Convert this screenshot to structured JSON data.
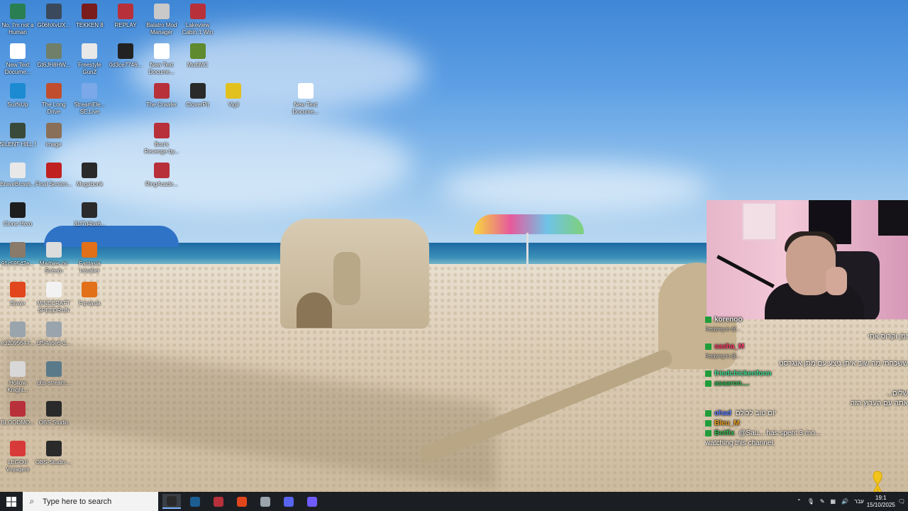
{
  "desktop": {
    "icons": [
      {
        "label": "No, I'm not a Human",
        "color": "#2a7f52"
      },
      {
        "label": "G06hXvUX...",
        "color": "#3a4a5c"
      },
      {
        "label": "TEKKEN 8",
        "color": "#7a1c1c"
      },
      {
        "label": "REPLAY",
        "color": "#b8303a"
      },
      {
        "label": "Balatro Mod Manager",
        "color": "#c9c9c9"
      },
      {
        "label": "Lakeview Cabin 1 Win",
        "color": "#b8303a"
      },
      {
        "label": "New Text Docume...",
        "color": "#ffffff"
      },
      {
        "label": "Gt6JH8HW...",
        "color": "#6f7f6a"
      },
      {
        "label": "Freestyle GunZ",
        "color": "#e8e8e8"
      },
      {
        "label": "0d3ce7746...",
        "color": "#222222"
      },
      {
        "label": "New Text Docume...",
        "color": "#ffffff"
      },
      {
        "label": "MultiMC",
        "color": "#5f8a2e"
      },
      {
        "label": "SurfsUp",
        "color": "#1d8bd1"
      },
      {
        "label": "The Long Drive",
        "color": "#c04e2e"
      },
      {
        "label": "StreamEle... SE.Live",
        "color": "#7aa8e8"
      },
      {
        "label": "The Crawler",
        "color": "#b8303a"
      },
      {
        "label": "CloverPit",
        "color": "#2a2a2a"
      },
      {
        "label": "Vigil",
        "color": "#e2c11e"
      },
      {
        "label": "New Text Docume...",
        "color": "#ffffff"
      },
      {
        "label": "SILENT HILL f",
        "color": "#3a4a3a"
      },
      {
        "label": "image",
        "color": "#8a6f58"
      },
      {
        "label": "Bou's Revenge by...",
        "color": "#b8303a"
      },
      {
        "label": "BraveBrows...",
        "color": "#e8e8e8"
      },
      {
        "label": "Final Senten...",
        "color": "#c02020"
      },
      {
        "label": "Megabonk",
        "color": "#2a2a2a"
      },
      {
        "label": "RingAcade...",
        "color": "#b8303a"
      },
      {
        "label": "Clone Hero",
        "color": "#1e1e1e"
      },
      {
        "label": "31f7d4ba6...",
        "color": "#2b2b2b"
      },
      {
        "label": "91c59542e...",
        "color": "#8a7a6a"
      },
      {
        "label": "Marbles on Stream",
        "color": "#dcdcdc"
      },
      {
        "label": "Fantasia Installer",
        "color": "#e27018"
      },
      {
        "label": "Brave",
        "color": "#e2461c"
      },
      {
        "label": "MINECRAFT SPEEDRUN",
        "color": "#f2f2f2"
      },
      {
        "label": "Fantasia",
        "color": "#e27018"
      },
      {
        "label": "e3209564-f...",
        "color": "#9aa4ad"
      },
      {
        "label": "bf54a6e6-d...",
        "color": "#9aa4ad"
      },
      {
        "label": "Hollow Knight...",
        "color": "#d8d8d8"
      },
      {
        "label": "obs-stream...",
        "color": "#5a7a8a"
      },
      {
        "label": "BLOODMO...",
        "color": "#b8303a"
      },
      {
        "label": "OBS Studio",
        "color": "#2a2a2a"
      },
      {
        "label": "LEGO® Voyagers",
        "color": "#d83a3a"
      },
      {
        "label": "OBS-Studio-...",
        "color": "#2a2a2a"
      }
    ]
  },
  "chat": {
    "lines": [
      {
        "kind": "user",
        "name": "korenoo",
        "name_color": "#e8e8e8",
        "text": ""
      },
      {
        "kind": "reply",
        "text": "Replying to @..."
      },
      {
        "kind": "msg",
        "text": "זמן וקרוס אחי"
      },
      {
        "kind": "user",
        "name": "sasha_M",
        "name_color": "#ff3b6b",
        "text": ""
      },
      {
        "kind": "reply",
        "text": "Replying to @..."
      },
      {
        "kind": "msg",
        "text": "ששכחתי מה שוב איתן ניצע עם מתן אנגרסט"
      },
      {
        "kind": "user",
        "name": "friedchickenfonn",
        "name_color": "#39d98a",
        "text": ""
      },
      {
        "kind": "user",
        "name": "asaaron....",
        "name_color": "#2fb34f",
        "text": ""
      },
      {
        "kind": "msg",
        "text": "שלום..."
      },
      {
        "kind": "msg",
        "text": "אתה עם הערוץ הזה"
      },
      {
        "kind": "user",
        "name": "ohad",
        "name_color": "#5a7bff",
        "text": "יום טוב לכולם"
      },
      {
        "kind": "user",
        "name": "Bleu_M",
        "name_color": "#e39b1e",
        "text": ""
      },
      {
        "kind": "user",
        "name": "Botfix",
        "name_color": "#2fb34f",
        "text": "@Sau... has spent 3 mo..."
      },
      {
        "kind": "msg",
        "text": "watching this channel."
      }
    ]
  },
  "taskbar": {
    "search_placeholder": "Type here to search",
    "apps": [
      {
        "name": "obs-app",
        "color": "#2a2a2a",
        "active": true
      },
      {
        "name": "steam-app",
        "color": "#1b5d91",
        "active": false
      },
      {
        "name": "winrar-app",
        "color": "#b8303a",
        "active": false
      },
      {
        "name": "brave-app",
        "color": "#e2461c",
        "active": false
      },
      {
        "name": "settings-app",
        "color": "#9aa4ad",
        "active": false
      },
      {
        "name": "discord-app",
        "color": "#5865f2",
        "active": false
      },
      {
        "name": "launcher-app",
        "color": "#6f5bff",
        "active": false
      }
    ],
    "language": "עבר",
    "time": "19:1",
    "date": "15/10/2025"
  }
}
